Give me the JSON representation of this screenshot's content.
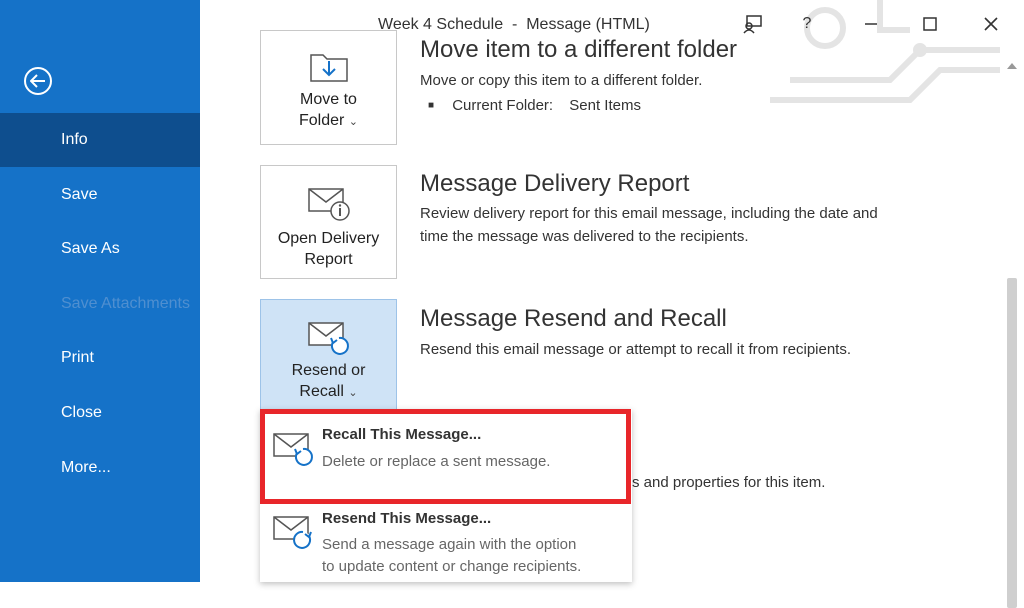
{
  "window": {
    "title": "Week 4 Schedule  -  Message (HTML)",
    "help_label": "?"
  },
  "sidebar": {
    "items": [
      {
        "label": "Info"
      },
      {
        "label": "Save"
      },
      {
        "label": "Save As"
      },
      {
        "label": "Save Attachments"
      },
      {
        "label": "Print"
      },
      {
        "label": "Close"
      },
      {
        "label": "More..."
      }
    ]
  },
  "sections": {
    "move": {
      "button_line1": "Move to",
      "button_line2": "Folder",
      "title": "Move item to a different folder",
      "description": "Move or copy this item to a different folder.",
      "bullet_label": "Current Folder:",
      "bullet_value": "Sent Items"
    },
    "delivery": {
      "button_line1": "Open Delivery",
      "button_line2": "Report",
      "title": "Message Delivery Report",
      "description_line1": "Review delivery report for this email message, including the date and",
      "description_line2": "time the message was delivered to the recipients."
    },
    "resend": {
      "button_line1": "Resend or",
      "button_line2": "Recall",
      "title": "Message Resend and Recall",
      "description": "Resend this email message or attempt to recall it from recipients."
    },
    "properties": {
      "partial_text": "s and properties for this item."
    }
  },
  "dropdown": {
    "recall": {
      "title": "Recall This Message...",
      "description": "Delete or replace a sent message."
    },
    "resend": {
      "title": "Resend This Message...",
      "description_line1": "Send a message again with the option",
      "description_line2": "to update content or change recipients."
    }
  },
  "colors": {
    "sidebar": "#1572c8",
    "sidebar_active": "#0e4e8e",
    "selected_card": "#cfe3f6",
    "highlight": "#e8262a"
  }
}
